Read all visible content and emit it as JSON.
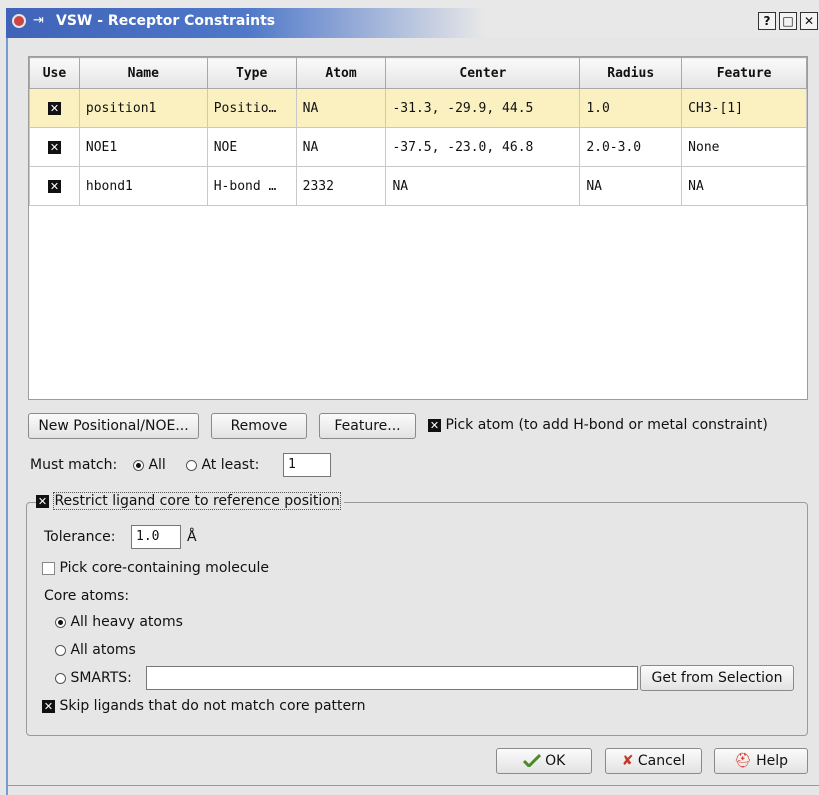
{
  "window": {
    "title": "VSW - Receptor Constraints",
    "buttons": [
      "?",
      "□",
      "✕"
    ]
  },
  "table": {
    "columns": [
      "Use",
      "Name",
      "Type",
      "Atom",
      "Center",
      "Radius",
      "Feature"
    ],
    "rows": [
      {
        "use": true,
        "name": "position1",
        "type": "Positio…",
        "atom": "NA",
        "center": "-31.3, -29.9, 44.5",
        "radius": "1.0",
        "feature": "CH3-[1]",
        "selected": true
      },
      {
        "use": true,
        "name": "NOE1",
        "type": "NOE",
        "atom": "NA",
        "center": "-37.5, -23.0, 46.8",
        "radius": "2.0-3.0",
        "feature": "None",
        "selected": false
      },
      {
        "use": true,
        "name": "hbond1",
        "type": "H-bond …",
        "atom": "2332",
        "center": "NA",
        "radius": "NA",
        "feature": "NA",
        "selected": false
      }
    ]
  },
  "actions": {
    "new_label": "New Positional/NOE...",
    "remove_label": "Remove",
    "feature_label": "Feature...",
    "pick_atom_label": "Pick atom (to add H-bond or metal constraint)"
  },
  "must_match": {
    "label": "Must match:",
    "all_label": "All",
    "at_least_label": "At least:",
    "at_least_value": "1"
  },
  "core": {
    "restrict_label": "Restrict ligand core to reference position",
    "tolerance_label": "Tolerance:",
    "tolerance_value": "1.0",
    "tolerance_unit": "Å",
    "pick_molecule_label": "Pick core-containing molecule",
    "core_atoms_label": "Core atoms:",
    "all_heavy_label": "All heavy atoms",
    "all_atoms_label": "All atoms",
    "smarts_label": "SMARTS:",
    "smarts_value": "",
    "get_selection_label": "Get from Selection",
    "skip_label": "Skip ligands that do not match core pattern"
  },
  "footer": {
    "ok_label": "OK",
    "cancel_label": "Cancel",
    "help_label": "Help"
  },
  "colors": {
    "title_bar": "#4066b8",
    "selected_row": "#fbf1c0"
  }
}
